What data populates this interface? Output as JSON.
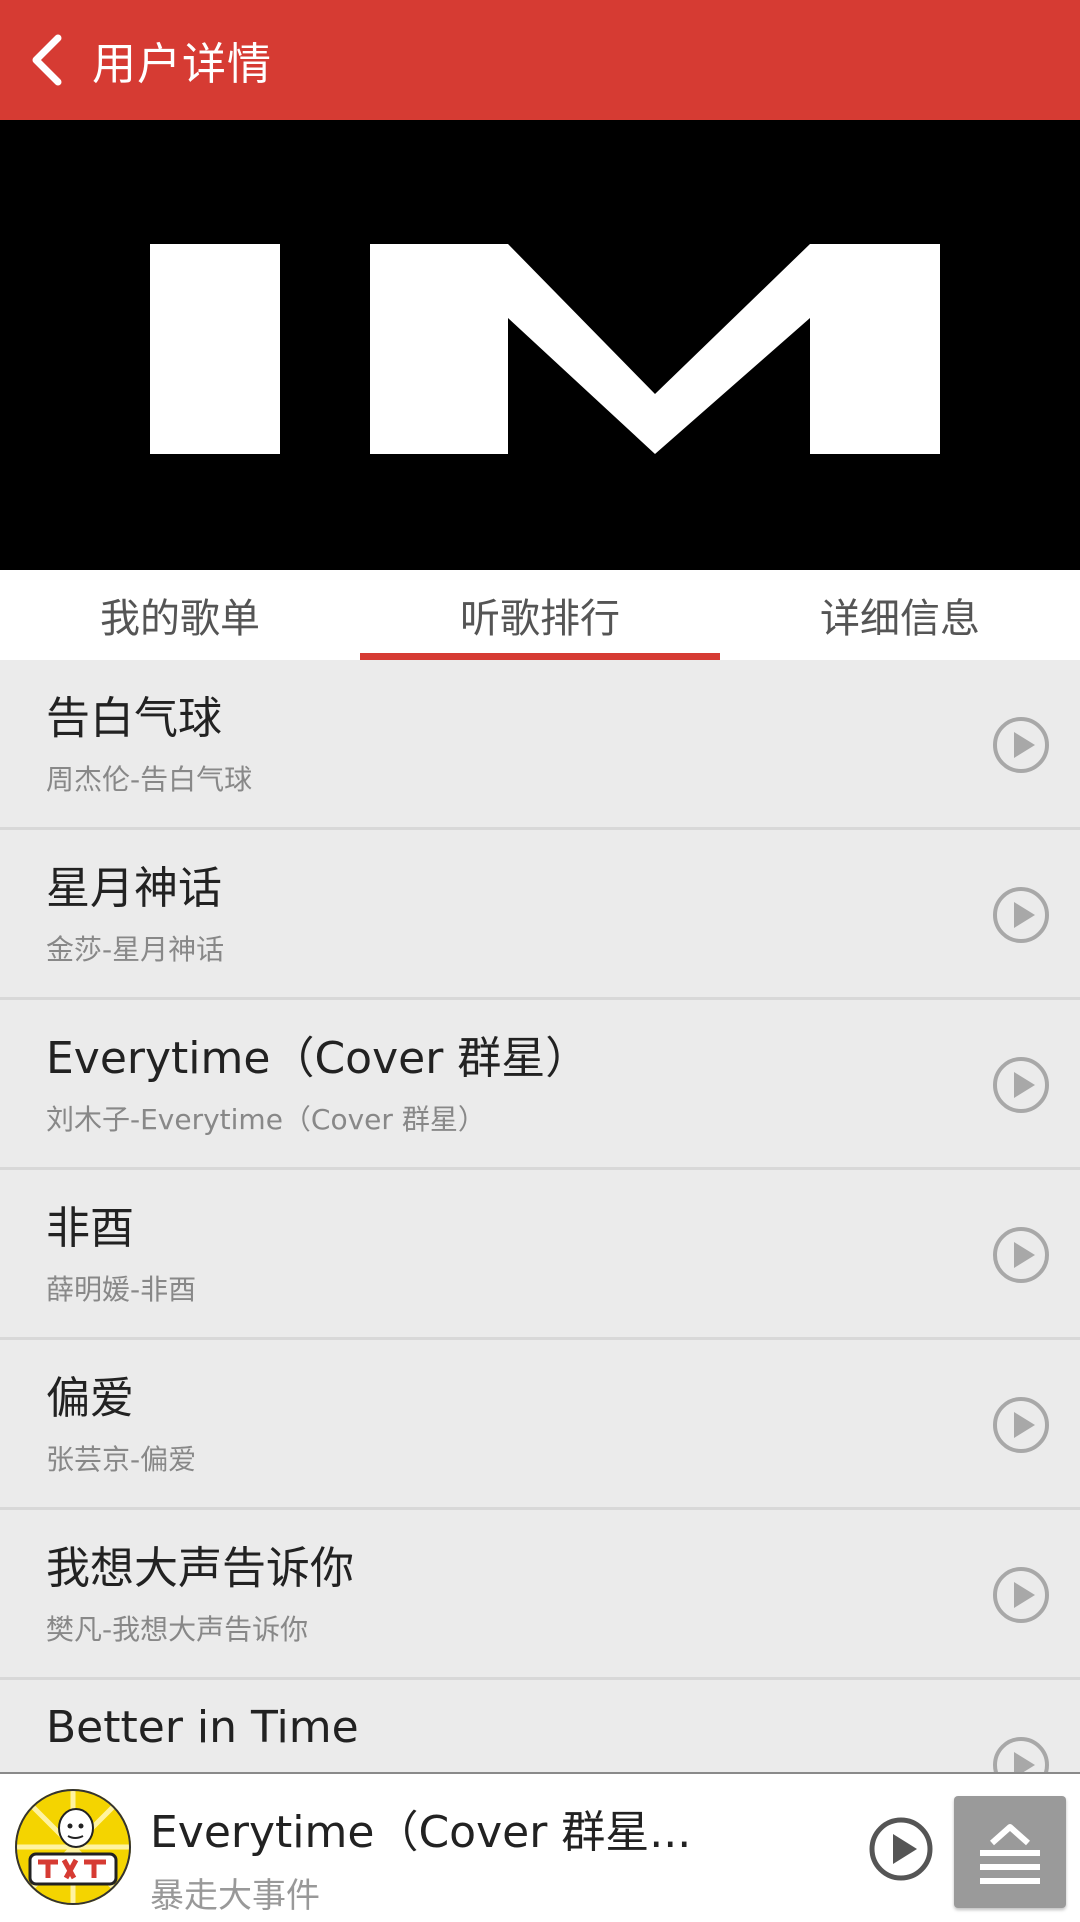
{
  "header": {
    "title": "用户详情",
    "color": "#d63b33"
  },
  "banner": {
    "logo_text": "IM"
  },
  "tabs": [
    {
      "label": "我的歌单",
      "active": false
    },
    {
      "label": "听歌排行",
      "active": true
    },
    {
      "label": "详细信息",
      "active": false
    }
  ],
  "songs": [
    {
      "title": "告白气球",
      "subtitle": "周杰伦-告白气球"
    },
    {
      "title": "星月神话",
      "subtitle": "金莎-星月神话"
    },
    {
      "title": "Everytime（Cover 群星）",
      "subtitle": "刘木子-Everytime（Cover 群星）"
    },
    {
      "title": "非酉",
      "subtitle": "薛明媛-非酉"
    },
    {
      "title": "偏爱",
      "subtitle": "张芸京-偏爱"
    },
    {
      "title": "我想大声告诉你",
      "subtitle": "樊凡-我想大声告诉你"
    },
    {
      "title": "Better in Time",
      "subtitle": ""
    }
  ],
  "player": {
    "title": "Everytime（Cover 群星...",
    "artist": "暴走大事件",
    "avatar_icon": "cartoon-avatar-icon"
  }
}
